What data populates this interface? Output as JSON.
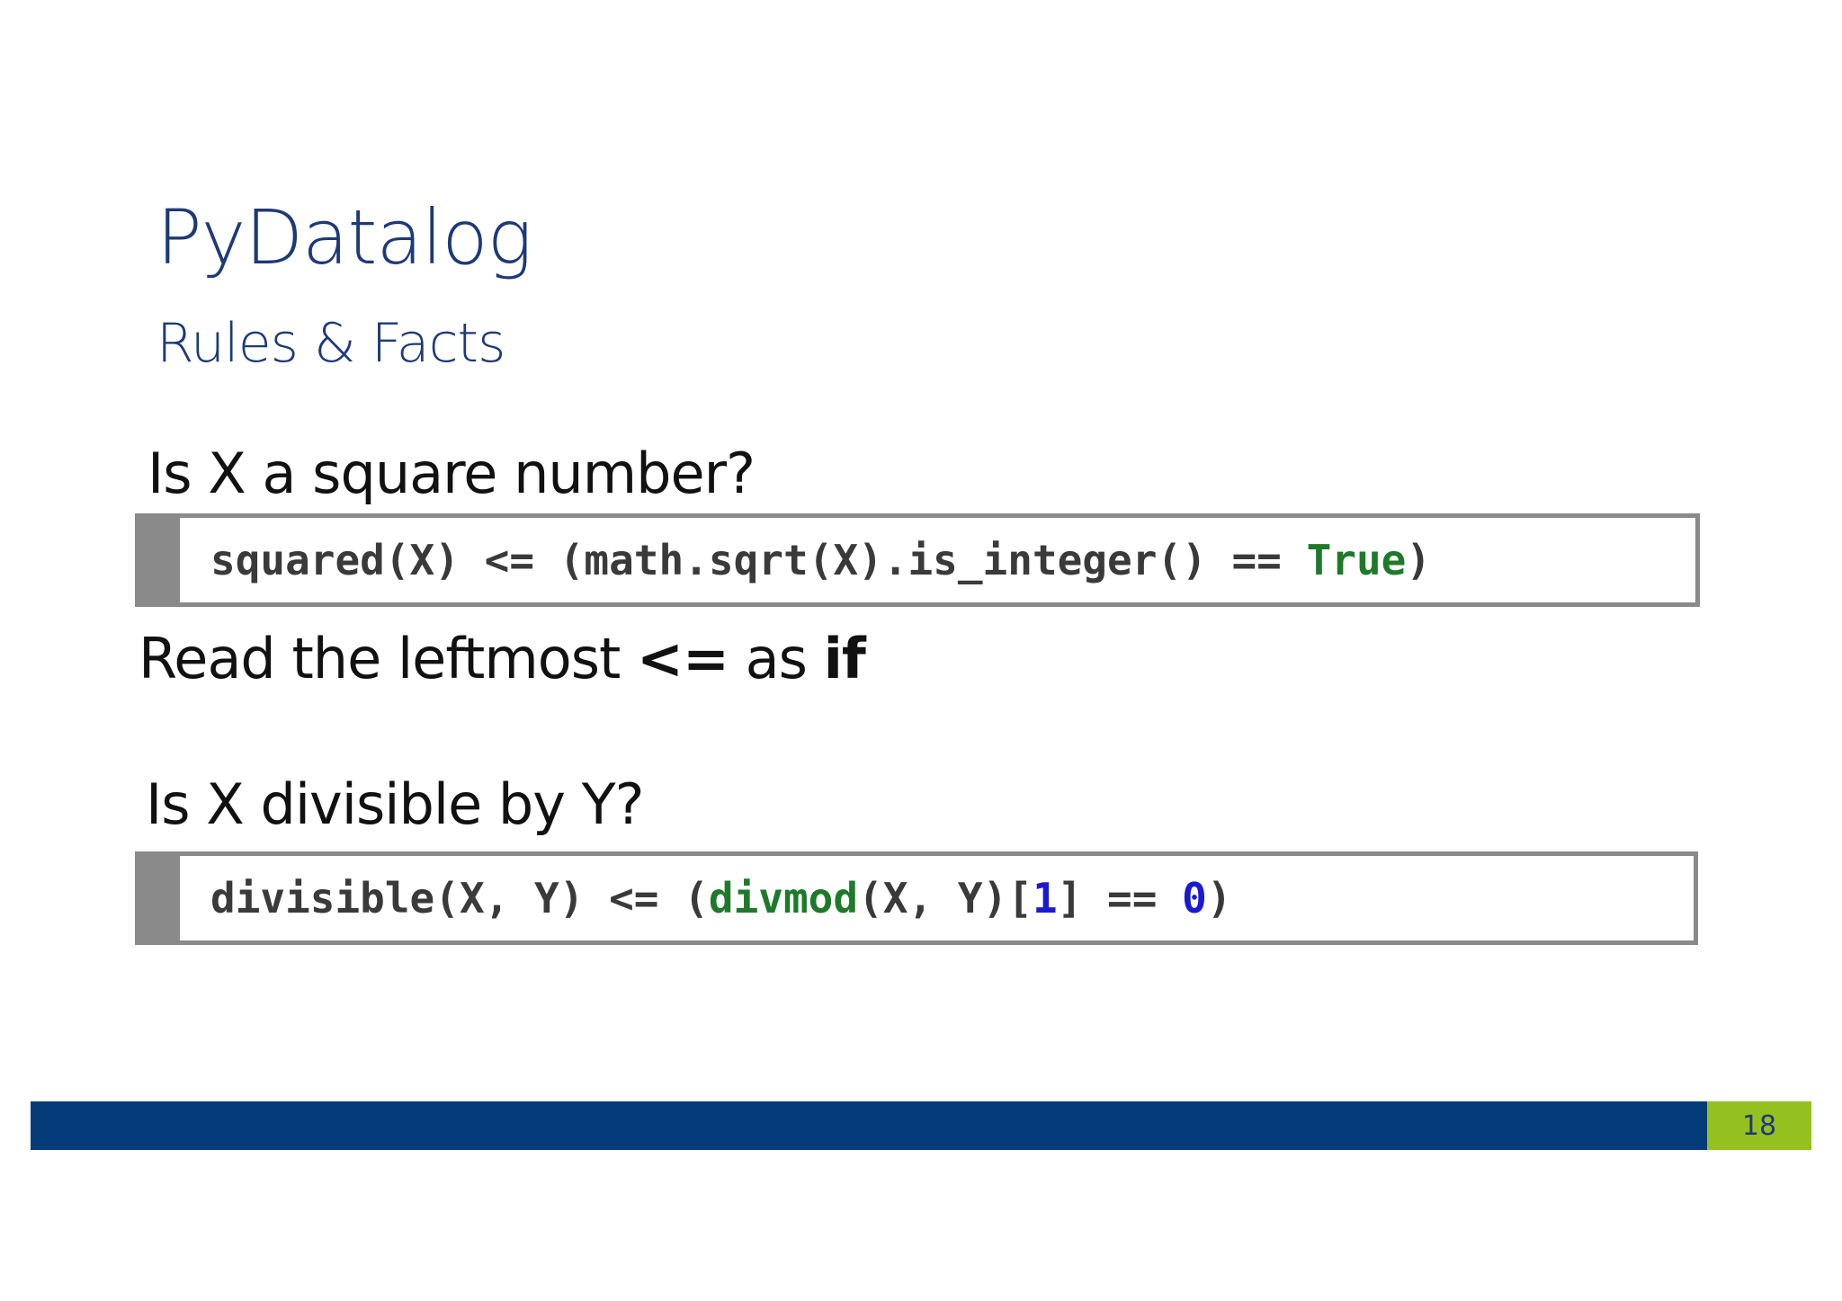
{
  "slide": {
    "title": "PyDatalog",
    "subtitle": "Rules & Facts",
    "question1": "Is X a square number?",
    "code1": {
      "part1": "squared(X) <= (math.sqrt(X).is_integer() == ",
      "kw_true": "True",
      "part2": ")"
    },
    "note": {
      "prefix": "Read the leftmost ",
      "op": "<=",
      "middle": " as ",
      "keyword": "if"
    },
    "question2": "Is X divisible by Y?",
    "code2": {
      "part1": "divisible(X, Y) <= (",
      "fn": "divmod",
      "part2": "(X, Y)[",
      "num1": "1",
      "part3": "] == ",
      "num0": "0",
      "part4": ")"
    },
    "page_number": "18"
  },
  "colors": {
    "title": "#1d3a78",
    "footer_bar": "#043c7a",
    "page_badge": "#94c11f",
    "code_border": "#8a8a8a",
    "code_green": "#1e7a2a",
    "code_blue": "#1a1ad0"
  }
}
